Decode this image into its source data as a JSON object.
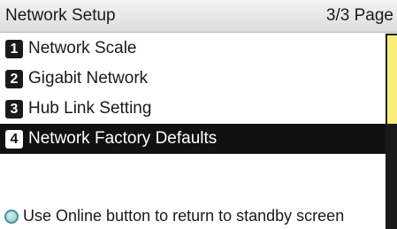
{
  "header": {
    "title": "Network Setup",
    "page_indicator": "3/3 Page"
  },
  "menu": {
    "items": [
      {
        "number": "1",
        "label": "Network Scale"
      },
      {
        "number": "2",
        "label": "Gigabit Network"
      },
      {
        "number": "3",
        "label": "Hub Link Setting"
      },
      {
        "number": "4",
        "label": "Network Factory Defaults"
      }
    ],
    "selected_index": 3
  },
  "footer": {
    "hint": "Use Online button to return to standby screen"
  },
  "colors": {
    "selection_background": "#111111",
    "scroll_thumb": "#f7ee7a",
    "online_led": "#8cc7c9"
  },
  "icons": {
    "online_indicator": "online-led-icon"
  }
}
